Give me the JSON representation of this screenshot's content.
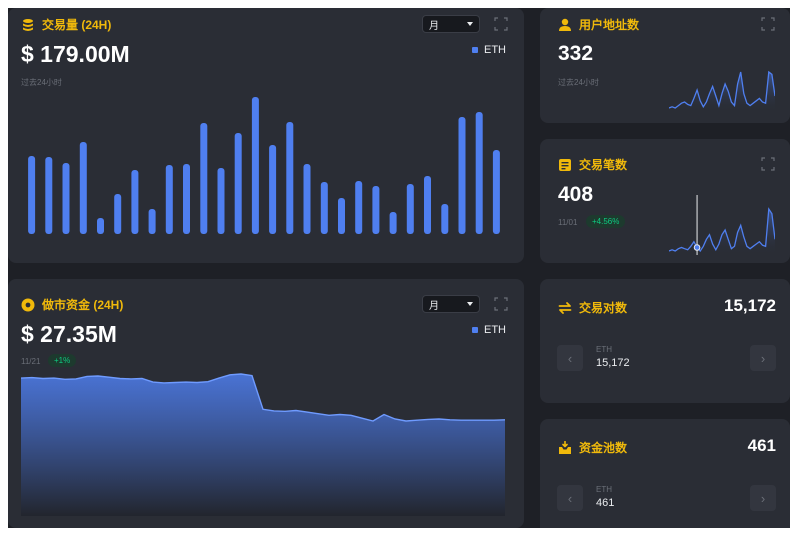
{
  "volume": {
    "title": "交易量 (24H)",
    "value": "$ 179.00M",
    "period_note": "过去24小时",
    "period_select": "月",
    "legend": "ETH",
    "bar_values": [
      78,
      77,
      71,
      92,
      16,
      40,
      64,
      25,
      69,
      70,
      111,
      66,
      101,
      137,
      89,
      112,
      70,
      52,
      36,
      53,
      48,
      22,
      50,
      58,
      30,
      117,
      122,
      84
    ]
  },
  "market_making": {
    "title": "做市资金 (24H)",
    "value": "$ 27.35M",
    "date": "11/21",
    "change": "+1%",
    "period_select": "月",
    "legend": "ETH",
    "area_values": [
      30.2,
      30.3,
      30.1,
      30.2,
      29.9,
      30.0,
      30.6,
      30.7,
      30.4,
      30.1,
      30.0,
      30.1,
      29.2,
      29.0,
      29.1,
      29.2,
      29.1,
      29.3,
      30.2,
      31.0,
      31.2,
      30.8,
      22.5,
      22.1,
      22.0,
      22.2,
      21.8,
      21.4,
      21.0,
      21.2,
      21.0,
      20.3,
      19.6,
      21.2,
      20.1,
      19.6,
      19.8,
      20.0,
      20.1,
      19.9,
      19.8,
      19.8,
      19.8,
      19.8,
      19.9
    ]
  },
  "users": {
    "title": "用户地址数",
    "value": "332",
    "period_note": "过去24小时",
    "spark": [
      10,
      11,
      10,
      12,
      14,
      15,
      13,
      12,
      18,
      25,
      16,
      11,
      15,
      22,
      28,
      20,
      12,
      22,
      30,
      24,
      15,
      12,
      30,
      40,
      22,
      14,
      12,
      14,
      16,
      18,
      15,
      14,
      40,
      38,
      20
    ]
  },
  "transactions": {
    "title": "交易笔数",
    "value": "408",
    "date": "11/01",
    "change": "+4.56%",
    "spark": [
      8,
      9,
      8,
      10,
      11,
      10,
      9,
      12,
      16,
      11,
      8,
      12,
      18,
      22,
      14,
      9,
      14,
      22,
      26,
      18,
      10,
      12,
      24,
      30,
      20,
      12,
      10,
      12,
      14,
      16,
      13,
      12,
      44,
      40,
      18
    ]
  },
  "pairs": {
    "title": "交易对数",
    "value": "15,172",
    "pager_label": "ETH",
    "pager_value": "15,172"
  },
  "pools": {
    "title": "资金池数",
    "value": "461",
    "pager_label": "ETH",
    "pager_value": "461"
  },
  "colors": {
    "accent": "#f0b90b",
    "bar": "#4f7ff0",
    "positive": "#0ecb81",
    "card": "#2a2d35",
    "page": "#1e2026"
  }
}
